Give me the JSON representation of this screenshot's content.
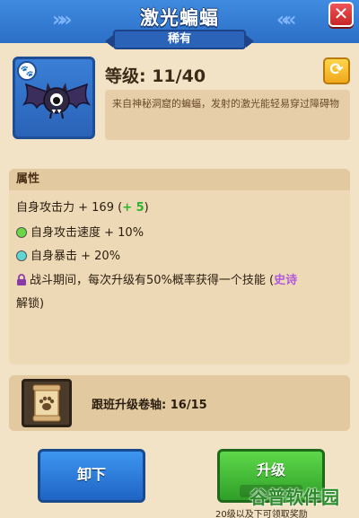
{
  "header": {
    "title": "激光蝙蝠",
    "rarity": "稀有"
  },
  "pet": {
    "level": "等级: 11/40",
    "description": "来自神秘洞窟的蝙蝠，发射的激光能轻易穿过障碍物"
  },
  "attributes": {
    "title": "属性",
    "attack_prefix": "自身攻击力 + 169 (",
    "attack_bonus": "+ 5",
    "attack_suffix": ")",
    "speed": "自身攻击速度 + 10%",
    "crit": "自身暴击 + 20%",
    "skill_prefix": "战斗期间，每次升级有50%概率获得一个技能 (",
    "skill_rarity": "史诗",
    "skill_line2": "解锁)"
  },
  "scroll": {
    "text": "跟班升级卷轴: 16/15"
  },
  "buttons": {
    "unload": "卸下",
    "upgrade": "升级"
  },
  "footer": {
    "note": "20级以及下可领取奖励"
  },
  "watermark": "谷普软件园",
  "colors": {
    "header_blue": "#2c6fc7",
    "close_red": "#d83030",
    "upgrade_green": "#3fb534",
    "unload_blue": "#2a7bd8",
    "bonus_green": "#2ab52a",
    "epic_purple": "#b15bd8"
  }
}
